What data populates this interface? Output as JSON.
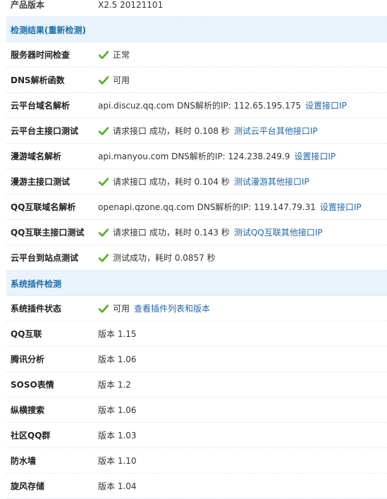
{
  "colors": {
    "accent": "#2366a8",
    "header_bg": "#eaf3fb",
    "check_green": "#4caf22"
  },
  "product": {
    "label": "产品版本",
    "value": "X2.5 20121101"
  },
  "check_section": {
    "title": "检测结果(重新检测)",
    "rows": [
      {
        "label": "服务器时间检查",
        "status": "正常"
      },
      {
        "label": "DNS解析函数",
        "status": "可用"
      },
      {
        "label": "云平台域名解析",
        "text": "api.discuz.qq.com DNS解析的IP: 112.65.195.175",
        "link": "设置接口IP"
      },
      {
        "label": "云平台主接口测试",
        "status": "请求接口 成功，耗时 0.108 秒",
        "link": "测试云平台其他接口IP"
      },
      {
        "label": "漫游域名解析",
        "text": "api.manyou.com DNS解析的IP: 124.238.249.9",
        "link": "设置接口IP"
      },
      {
        "label": "漫游主接口测试",
        "status": "请求接口 成功，耗时 0.104 秒",
        "link": "测试漫游其他接口IP"
      },
      {
        "label": "QQ互联域名解析",
        "text": "openapi.qzone.qq.com DNS解析的IP: 119.147.79.31",
        "link": "设置接口IP"
      },
      {
        "label": "QQ互联主接口测试",
        "status": "请求接口 成功，耗时 0.143 秒",
        "link": "测试QQ互联其他接口IP"
      },
      {
        "label": "云平台到站点测试",
        "status": "测试成功，耗时 0.0857 秒"
      }
    ]
  },
  "plugin_section": {
    "title": "系统插件检测",
    "status_row": {
      "label": "系统插件状态",
      "status": "可用",
      "link": "查看插件列表和版本"
    },
    "plugins": [
      {
        "label": "QQ互联",
        "version": "版本 1.15"
      },
      {
        "label": "腾讯分析",
        "version": "版本 1.06"
      },
      {
        "label": "SOSO表情",
        "version": "版本 1.2"
      },
      {
        "label": "纵横搜索",
        "version": "版本 1.06"
      },
      {
        "label": "社区QQ群",
        "version": "版本 1.03"
      },
      {
        "label": "防水墙",
        "version": "版本 1.10"
      },
      {
        "label": "旋风存储",
        "version": "版本 1.04"
      }
    ]
  }
}
